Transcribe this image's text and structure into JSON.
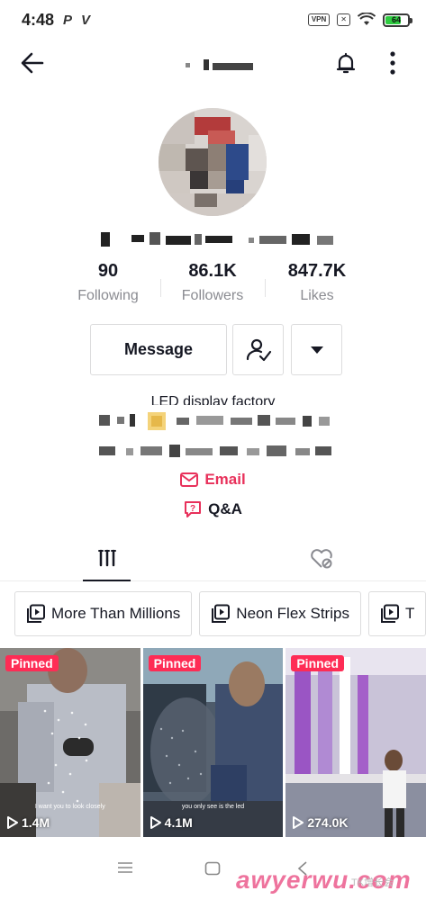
{
  "status": {
    "time": "4:48",
    "battery": "64",
    "vpn": "VPN"
  },
  "profile": {
    "following_count": "90",
    "following_label": "Following",
    "followers_count": "86.1K",
    "followers_label": "Followers",
    "likes_count": "847.7K",
    "likes_label": "Likes",
    "bio_title": "LED display factory"
  },
  "actions": {
    "message_label": "Message"
  },
  "links": {
    "email_label": "Email",
    "qa_label": "Q&A"
  },
  "playlists": [
    "More Than Millions",
    "Neon Flex Strips",
    "T"
  ],
  "videos": [
    {
      "pinned": "Pinned",
      "views": "1.4M",
      "caption": "I want you to look closely"
    },
    {
      "pinned": "Pinned",
      "views": "4.1M",
      "caption": "you only see is the led"
    },
    {
      "pinned": "Pinned",
      "views": "274.0K",
      "caption": ""
    }
  ],
  "watermark": {
    "text": "awyerwu.com",
    "small": "TK增长会"
  },
  "colors": {
    "accent": "#fe2c55",
    "email": "#e8315b"
  }
}
